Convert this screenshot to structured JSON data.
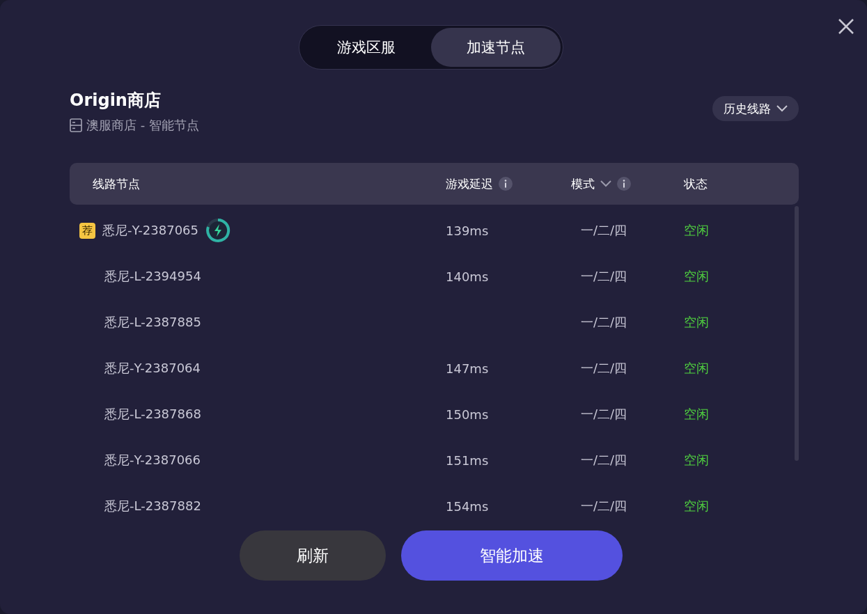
{
  "tabs": [
    {
      "label": "游戏区服",
      "selected": false
    },
    {
      "label": "加速节点",
      "selected": true
    }
  ],
  "game": {
    "title": "Origin商店",
    "subtitle": "澳服商店 - 智能节点"
  },
  "history_button": {
    "label": "历史线路"
  },
  "table": {
    "columns": [
      {
        "label": "线路节点",
        "info": false,
        "sortable": false
      },
      {
        "label": "游戏延迟",
        "info": true,
        "sortable": false
      },
      {
        "label": "模式",
        "info": true,
        "sortable": true
      },
      {
        "label": "状态",
        "info": false,
        "sortable": false
      }
    ],
    "rows": [
      {
        "recommended": true,
        "badge": "荐",
        "boost": true,
        "node": "悉尼-Y-2387065",
        "latency": "139ms",
        "mode": "一/二/四",
        "status": "空闲"
      },
      {
        "recommended": false,
        "boost": false,
        "node": "悉尼-L-2394954",
        "latency": "140ms",
        "mode": "一/二/四",
        "status": "空闲"
      },
      {
        "recommended": false,
        "boost": false,
        "node": "悉尼-L-2387885",
        "mode": "一/二/四",
        "status": "空闲"
      },
      {
        "recommended": false,
        "boost": false,
        "node": "悉尼-Y-2387064",
        "latency": "147ms",
        "mode": "一/二/四",
        "status": "空闲"
      },
      {
        "recommended": false,
        "boost": false,
        "node": "悉尼-L-2387868",
        "latency": "150ms",
        "mode": "一/二/四",
        "status": "空闲"
      },
      {
        "recommended": false,
        "boost": false,
        "node": "悉尼-Y-2387066",
        "latency": "151ms",
        "mode": "一/二/四",
        "status": "空闲"
      },
      {
        "recommended": false,
        "boost": false,
        "node": "悉尼-L-2387882",
        "latency": "154ms",
        "mode": "一/二/四",
        "status": "空闲"
      }
    ]
  },
  "buttons": [
    {
      "kind": "secondary",
      "label": "刷新"
    },
    {
      "kind": "primary",
      "label": "智能加速"
    }
  ]
}
